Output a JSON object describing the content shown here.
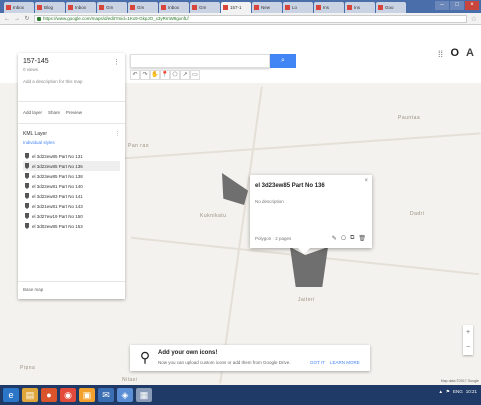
{
  "browser": {
    "tabs": [
      {
        "label": "Inbox"
      },
      {
        "label": "Blog"
      },
      {
        "label": "Inbox"
      },
      {
        "label": "Gm"
      },
      {
        "label": "Gm"
      },
      {
        "label": "Inbox"
      },
      {
        "label": "Gm"
      },
      {
        "label": "157-1"
      },
      {
        "label": "New"
      },
      {
        "label": "Lo"
      },
      {
        "label": "Ins"
      },
      {
        "label": "Ins"
      },
      {
        "label": "Goo"
      }
    ],
    "url": "https://www.google.com/maps/d/edit?mid=1Kx9-GkpJO_x3yRmW8gxnfLf"
  },
  "map": {
    "search": {
      "placeholder": ""
    },
    "search_button": "⌕",
    "tools": [
      "↶",
      "↷",
      "✋",
      "📍",
      "⬠",
      "↗",
      "▭"
    ],
    "labels": [
      {
        "text": "Pan rao"
      },
      {
        "text": "Kuknikatu"
      },
      {
        "text": "Pauntaa"
      },
      {
        "text": "Jaiteri"
      },
      {
        "text": "Dadri"
      },
      {
        "text": "Pipna"
      },
      {
        "text": "Nilasi"
      }
    ]
  },
  "panel": {
    "title": "157-145",
    "subtitle": "0 views",
    "description": "Add a description for this map",
    "actions": [
      "Add layer",
      "Share",
      "Preview"
    ],
    "layer": {
      "name": "KML Layer",
      "link": "Individual styles",
      "items": [
        "el 3d22ew85 Part No 131",
        "el 3d22ew85 Part No 136",
        "el 3d23ew85 Part No 138",
        "el 3d22ew81 Part No 140",
        "el 3d22ew83 Part No 141",
        "el 3d21ew81 Part No 143",
        "el 3d27ew19 Part No 150",
        "el 3d02ew85 Part No 153"
      ],
      "selected_index": 1
    },
    "basemap": "Base map"
  },
  "popup": {
    "title": "el 3d23ew85 Part No 136",
    "description": "No description",
    "close": "×",
    "meta": "Polygon · 2 pages",
    "tools": [
      "✎",
      "⎔",
      "⧉",
      "🗑"
    ]
  },
  "notification": {
    "title": "Add your own icons!",
    "body": "Now you can upload custom icons or add them from Google Drive.",
    "btn_primary": "GOT IT",
    "btn_secondary": "LEARN MORE"
  },
  "zoom": {
    "in": "+",
    "out": "−"
  },
  "footer": "Map data ©2017 Google",
  "taskbar": {
    "apps": [
      "e",
      "▤",
      "●",
      "◉",
      "▣",
      "✉",
      "◈",
      "▦"
    ],
    "tray": [
      "▲",
      "⚑",
      "ENG"
    ],
    "time": "10:21"
  },
  "colors": {
    "accent": "#4285f4",
    "polygon": "#6f6f6f",
    "taskbar": "#1f3a67"
  }
}
